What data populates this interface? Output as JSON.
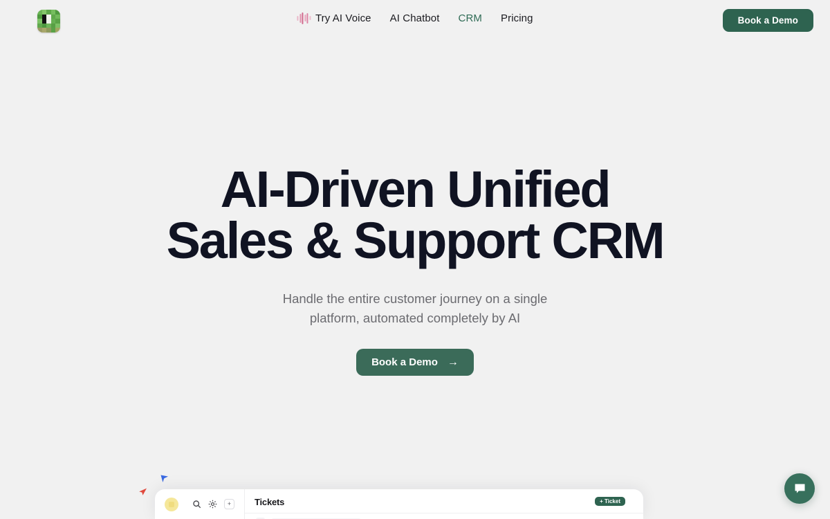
{
  "brand": {
    "logo_icon": "pixel-grid-logo",
    "accent_green": "#2e6350",
    "cta_green": "#3b6b59",
    "nav_active_green": "#2f6b55",
    "page_background": "#f1f1f1"
  },
  "header": {
    "nav": [
      {
        "label": "Try AI Voice",
        "icon": "audio-waveform-icon",
        "active": false
      },
      {
        "label": "AI Chatbot",
        "icon": "",
        "active": false
      },
      {
        "label": "CRM",
        "icon": "",
        "active": true
      },
      {
        "label": "Pricing",
        "icon": "",
        "active": false
      }
    ],
    "cta_label": "Book a Demo"
  },
  "hero": {
    "title_line1": "AI-Driven Unified",
    "title_line2": "Sales & Support CRM",
    "subtitle_line1": "Handle the entire customer journey on a single",
    "subtitle_line2": "platform, automated completely by AI",
    "cta_label": "Book a Demo",
    "cta_arrow": "→"
  },
  "mockup": {
    "avatar_icon": "user-avatar",
    "search_icon": "search-icon",
    "settings_icon": "gear-icon",
    "add_icon": "plus-icon",
    "add_label": "+",
    "panel_title": "Tickets",
    "new_ticket_label": "+ Ticket"
  },
  "cursors": [
    {
      "name": "blue-cursor",
      "color": "#3b6ae1"
    },
    {
      "name": "red-cursor",
      "color": "#e0493c"
    }
  ],
  "chat_widget": {
    "icon": "chat-bubble-icon",
    "color": "#37705c"
  }
}
